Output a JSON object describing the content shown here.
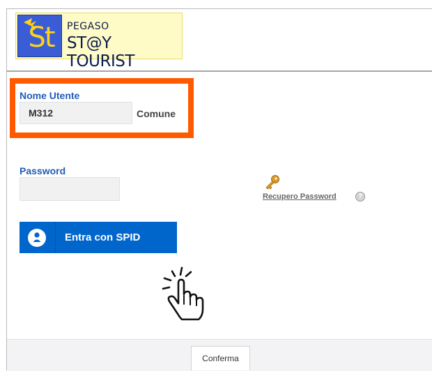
{
  "logo": {
    "mark": "St",
    "line1": "PEGASO",
    "line2": "ST@Y TOURIST",
    "colors": {
      "mark_bg": "#3a5dd6",
      "mark_letters": "#ffd21a",
      "badge_bg": "#fffbc7"
    }
  },
  "login": {
    "username_label": "Nome Utente",
    "username_value": "M312",
    "username_suffix": "Comune",
    "password_label": "Password",
    "password_value": "",
    "recovery_link": "Recupero Password",
    "help_icon": "?",
    "spid_button": "Entra con SPID"
  },
  "footer": {
    "confirm_button": "Conferma"
  },
  "icons": [
    "angel-icon",
    "key-icon",
    "help-icon",
    "user-icon",
    "hand-cursor-icon"
  ],
  "colors": {
    "highlight": "#ff5a00",
    "spid_blue": "#0066cc",
    "label_blue": "#1f5cb8"
  }
}
